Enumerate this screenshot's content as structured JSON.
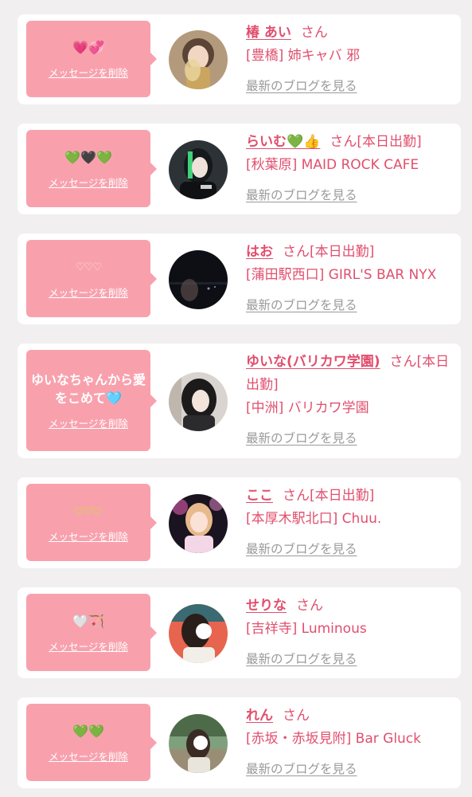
{
  "entries": [
    {
      "message": "💗💞",
      "delete_label": "メッセージを削除",
      "name": "椿 あい",
      "suffix": "さん",
      "shop": "[豊橋] 姉キャバ 邪",
      "blog_label": "最新のブログを見る"
    },
    {
      "message": "💚🖤💚",
      "delete_label": "メッセージを削除",
      "name": "らいむ💚👍",
      "suffix": "さん[本日出勤]",
      "shop": "[秋葉原] MAID ROCK CAFE",
      "blog_label": "最新のブログを見る"
    },
    {
      "message": "♡♡♡",
      "delete_label": "メッセージを削除",
      "name": "はお",
      "suffix": "さん[本日出勤]",
      "shop": "[蒲田駅西口] GIRL'S BAR NYX",
      "blog_label": "最新のブログを見る"
    },
    {
      "message": "ゆいなちゃんから愛をこめて🩵",
      "delete_label": "メッセージを削除",
      "name": "ゆいな(バリカワ学園)",
      "suffix": "さん[本日出勤]",
      "shop": "[中洲] バリカワ学園",
      "blog_label": "最新のブログを見る"
    },
    {
      "message": "ᗢᗢᗢ",
      "delete_label": "メッセージを削除",
      "name": "ここ",
      "suffix": "さん[本日出勤]",
      "shop": "[本厚木駅北口] Chuu.",
      "blog_label": "最新のブログを見る"
    },
    {
      "message": "🤍🏹",
      "delete_label": "メッセージを削除",
      "name": "せりな",
      "suffix": "さん",
      "shop": "[吉祥寺] Luminous",
      "blog_label": "最新のブログを見る"
    },
    {
      "message": "💚💚",
      "delete_label": "メッセージを削除",
      "name": "れん",
      "suffix": "さん",
      "shop": "[赤坂・赤坂見附] Bar Gluck",
      "blog_label": "最新のブログを見る"
    }
  ],
  "colors": {
    "page_bg": "#f1eff0",
    "card_bg": "#ffffff",
    "bubble_bg": "#f8a1ad",
    "accent_text": "#e14f6e",
    "link_gray": "#9a9a9a"
  }
}
